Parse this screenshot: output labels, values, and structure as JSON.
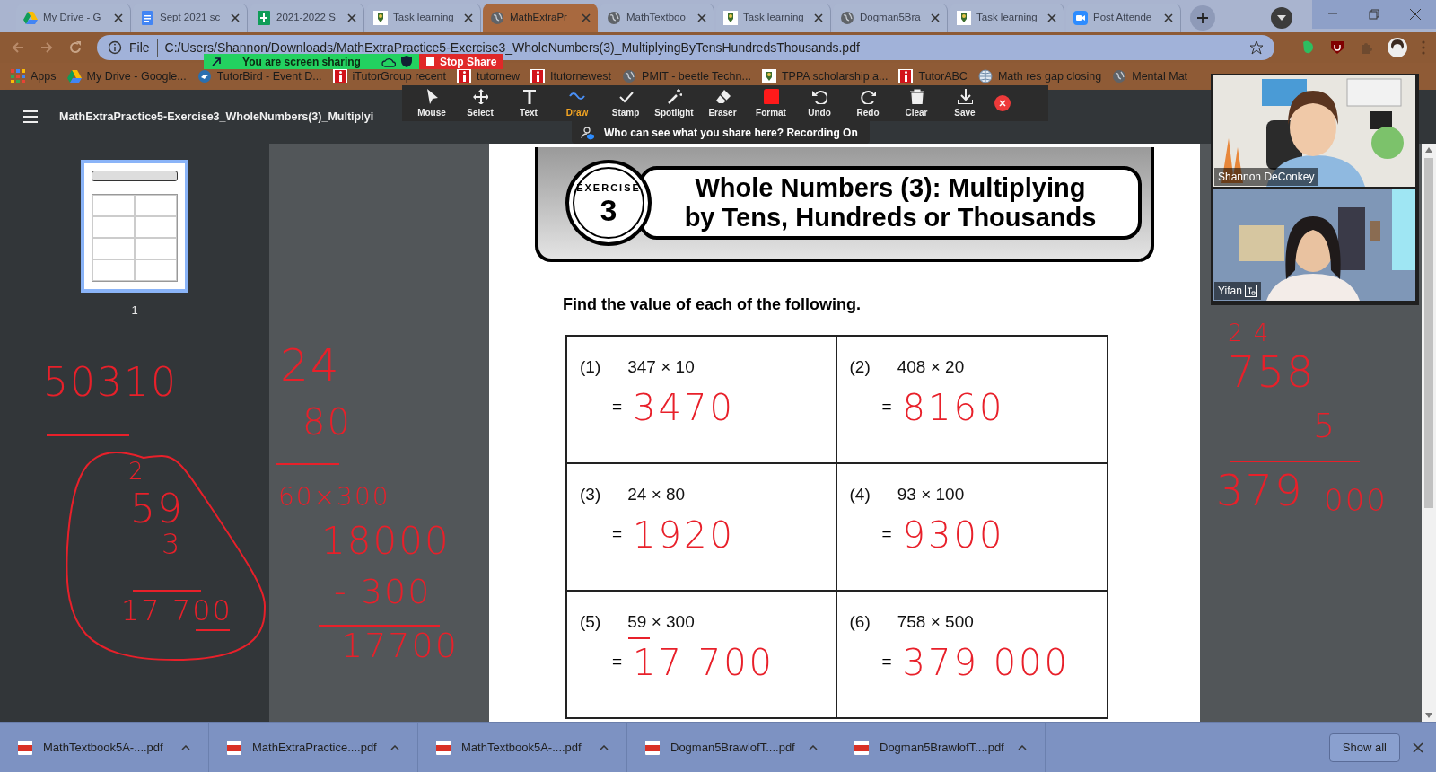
{
  "tabs": [
    {
      "title": "My Drive - G",
      "selected": false
    },
    {
      "title": "Sept 2021 sc",
      "selected": false
    },
    {
      "title": "2021-2022 S",
      "selected": false
    },
    {
      "title": "Task learning",
      "selected": false
    },
    {
      "title": "MathExtraPr",
      "selected": true
    },
    {
      "title": "MathTextboo",
      "selected": false
    },
    {
      "title": "Task learning",
      "selected": false
    },
    {
      "title": "Dogman5Bra",
      "selected": false
    },
    {
      "title": "Task learning",
      "selected": false
    },
    {
      "title": "Post Attende",
      "selected": false
    }
  ],
  "address": {
    "scheme": "File",
    "url": "C:/Users/Shannon/Downloads/MathExtraPractice5-Exercise3_WholeNumbers(3)_MultiplyingByTensHundredsThousands.pdf"
  },
  "bookmarks": [
    "Apps",
    "My Drive - Google...",
    "TutorBird - Event D...",
    "iTutorGroup recent",
    "tutornew",
    "Itutornewest",
    "PMIT - beetle Techn...",
    "TPPA scholarship a...",
    "TutorABC",
    "Math res gap closing",
    "Mental Mat"
  ],
  "share_banner": {
    "status": "You are screen sharing",
    "stop_button": "Stop Share"
  },
  "annotation_toolbar": {
    "tools": [
      {
        "label": "Mouse",
        "selected": false
      },
      {
        "label": "Select",
        "selected": false
      },
      {
        "label": "Text",
        "selected": false
      },
      {
        "label": "Draw",
        "selected": true
      },
      {
        "label": "Stamp",
        "selected": false
      },
      {
        "label": "Spotlight",
        "selected": false
      },
      {
        "label": "Eraser",
        "selected": false
      },
      {
        "label": "Format",
        "selected": false
      },
      {
        "label": "Undo",
        "selected": false
      },
      {
        "label": "Redo",
        "selected": false
      },
      {
        "label": "Clear",
        "selected": false
      },
      {
        "label": "Save",
        "selected": false
      }
    ],
    "notice": "Who can see what you share here? Recording On"
  },
  "pdf_viewer": {
    "title": "MathExtraPractice5-Exercise3_WholeNumbers(3)_Multiplyi",
    "thumbnails": [
      {
        "page": "1",
        "selected": true
      }
    ],
    "page": {
      "exercise_label": "EXERCISE",
      "exercise_number": "3",
      "title_lines": [
        "Whole Numbers (3): Multiplying",
        "by Tens, Hundreds or Thousands"
      ],
      "instruction": "Find the value of each of the following.",
      "questions": [
        {
          "number": "(1)",
          "expression": "347 × 10",
          "equals": "=",
          "answer": "3470"
        },
        {
          "number": "(2)",
          "expression": "408 × 20",
          "equals": "=",
          "answer": "8160"
        },
        {
          "number": "(3)",
          "expression": "24 × 80",
          "equals": "=",
          "answer": "1920"
        },
        {
          "number": "(4)",
          "expression": "93 × 100",
          "equals": "=",
          "answer": "9300"
        },
        {
          "number": "(5)",
          "expression": "59 × 300",
          "equals": "=",
          "answer": "17 700"
        },
        {
          "number": "(6)",
          "expression": "758 × 500",
          "equals": "=",
          "answer": "379 000"
        }
      ]
    }
  },
  "ink": [
    "50310",
    "2",
    "59",
    "3",
    "17 700",
    "24",
    "80",
    "60×300",
    "18000",
    "- 300",
    "17700",
    "2 4",
    "758",
    "5",
    "379",
    "000"
  ],
  "video": {
    "participants": [
      {
        "name": "Shannon DeConkey",
        "captions_badge": false
      },
      {
        "name": "Yifan",
        "captions_badge": true
      }
    ]
  },
  "downloads": {
    "items": [
      "MathTextbook5A-....pdf",
      "MathExtraPractice....pdf",
      "MathTextbook5A-....pdf",
      "Dogman5BrawlofT....pdf",
      "Dogman5BrawlofT....pdf"
    ],
    "show_all": "Show all"
  }
}
